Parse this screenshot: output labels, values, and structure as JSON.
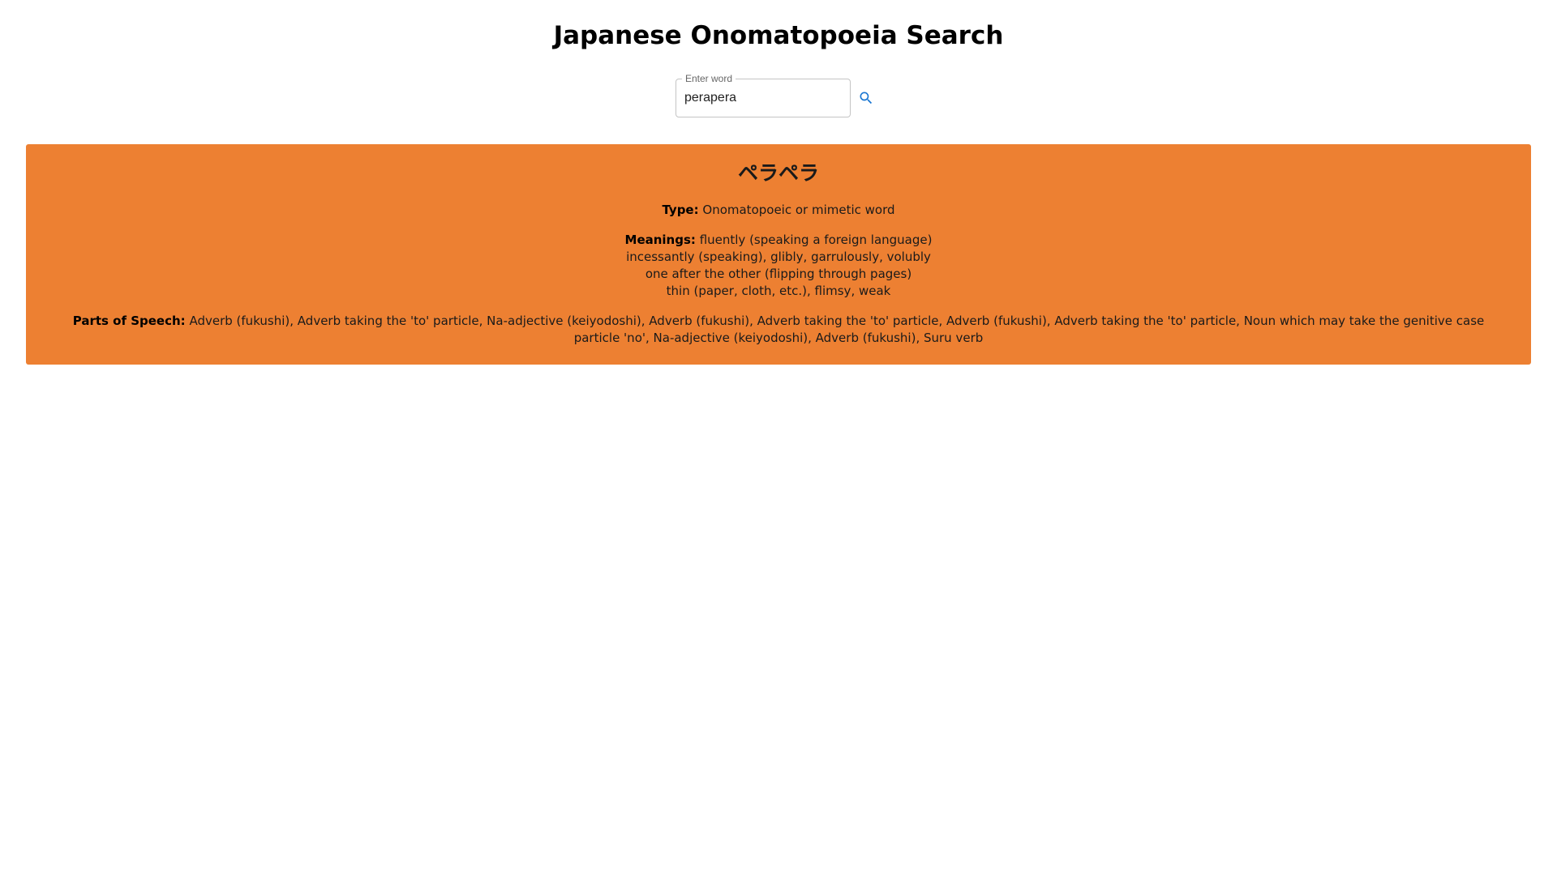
{
  "header": {
    "title": "Japanese Onomatopoeia Search"
  },
  "search": {
    "label": "Enter word",
    "value": "perapera",
    "button_icon": "search-icon"
  },
  "result": {
    "word": "ペラペラ",
    "type_label": "Type:",
    "type_value": "Onomatopoeic or mimetic word",
    "meanings_label": "Meanings:",
    "meanings": [
      "fluently (speaking a foreign language)",
      "incessantly (speaking), glibly, garrulously, volubly",
      "one after the other (flipping through pages)",
      "thin (paper, cloth, etc.), flimsy, weak"
    ],
    "pos_label": "Parts of Speech:",
    "pos_value": "Adverb (fukushi), Adverb taking the 'to' particle, Na-adjective (keiyodoshi), Adverb (fukushi), Adverb taking the 'to' particle, Adverb (fukushi), Adverb taking the 'to' particle, Noun which may take the genitive case particle 'no', Na-adjective (keiyodoshi), Adverb (fukushi), Suru verb"
  },
  "colors": {
    "card_background": "#ed8032",
    "search_icon": "#1976d2"
  }
}
